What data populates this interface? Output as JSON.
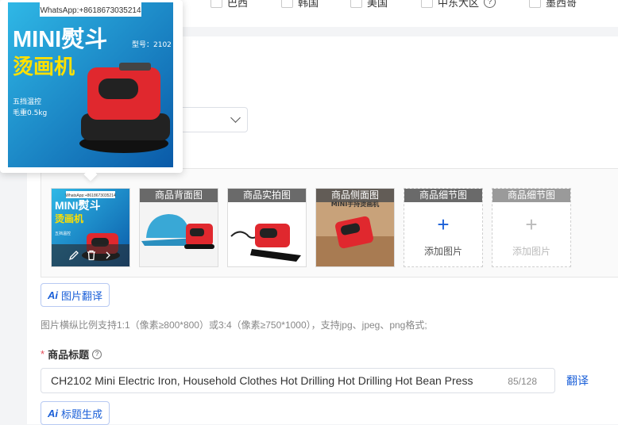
{
  "countries": [
    {
      "label": "巴西",
      "has_help": false
    },
    {
      "label": "韩国",
      "has_help": false
    },
    {
      "label": "美国",
      "has_help": false
    },
    {
      "label": "中东大区",
      "has_help": true
    },
    {
      "label": "墨西哥",
      "has_help": false
    }
  ],
  "popup": {
    "watermark": "WhatsApp:+8618673035214",
    "product_title": "MINI熨斗",
    "subtitle": "烫画机",
    "model": "型号：2102",
    "spec1": "五挡温控",
    "spec2": "毛重0.5kg"
  },
  "images": {
    "main_watermark": "WhatsApp:+8618673035214",
    "main_title": "MINI熨斗",
    "main_subtitle": "烫画机",
    "main_spec": "五挡温控",
    "slots": [
      {
        "caption": "商品背面图"
      },
      {
        "caption": "商品实拍图"
      },
      {
        "caption": "商品侧面图",
        "inner_text": "MINI手持烫画机"
      },
      {
        "caption": "商品细节图",
        "add_label": "添加图片"
      },
      {
        "caption": "商品细节图",
        "add_label": "添加图片"
      }
    ]
  },
  "buttons": {
    "ai_icon": "Ai",
    "image_translate": "图片翻译",
    "title_generate": "标题生成",
    "translate": "翻译"
  },
  "hint": "图片横纵比例支持1:1（像素≥800*800）或3:4（像素≥750*1000），支持jpg、jpeg、png格式;",
  "title_field": {
    "required_mark": "*",
    "label": "商品标题",
    "value": "CH2102 Mini Electric Iron, Household Clothes Hot Drilling Hot Drilling Hot Bean Press",
    "counter": "85/128"
  },
  "colors": {
    "accent": "#1a5fd8",
    "required": "#e34d59",
    "product_red": "#e0282e",
    "banner_blue": "#1aa0d8"
  }
}
